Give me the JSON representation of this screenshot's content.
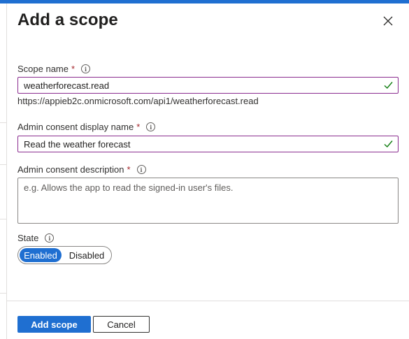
{
  "panel": {
    "title": "Add a scope"
  },
  "fields": {
    "scope_name": {
      "label": "Scope name",
      "required_mark": "*",
      "value": "weatherforecast.read",
      "full_uri": "https://appieb2c.onmicrosoft.com/api1/weatherforecast.read"
    },
    "admin_consent_display_name": {
      "label": "Admin consent display name",
      "required_mark": "*",
      "value": "Read the weather forecast"
    },
    "admin_consent_description": {
      "label": "Admin consent description",
      "required_mark": "*",
      "value": "",
      "placeholder": "e.g. Allows the app to read the signed-in user's files."
    },
    "state": {
      "label": "State",
      "options": [
        "Enabled",
        "Disabled"
      ],
      "selected": "Enabled"
    }
  },
  "footer": {
    "primary_label": "Add scope",
    "cancel_label": "Cancel"
  },
  "colors": {
    "accent": "#1f6fd1",
    "focus_border": "#8a2c8f",
    "valid_check": "#107c10",
    "required": "#a4262c"
  },
  "icons": {
    "close": "close-icon",
    "info": "info-icon",
    "valid": "checkmark-icon"
  }
}
